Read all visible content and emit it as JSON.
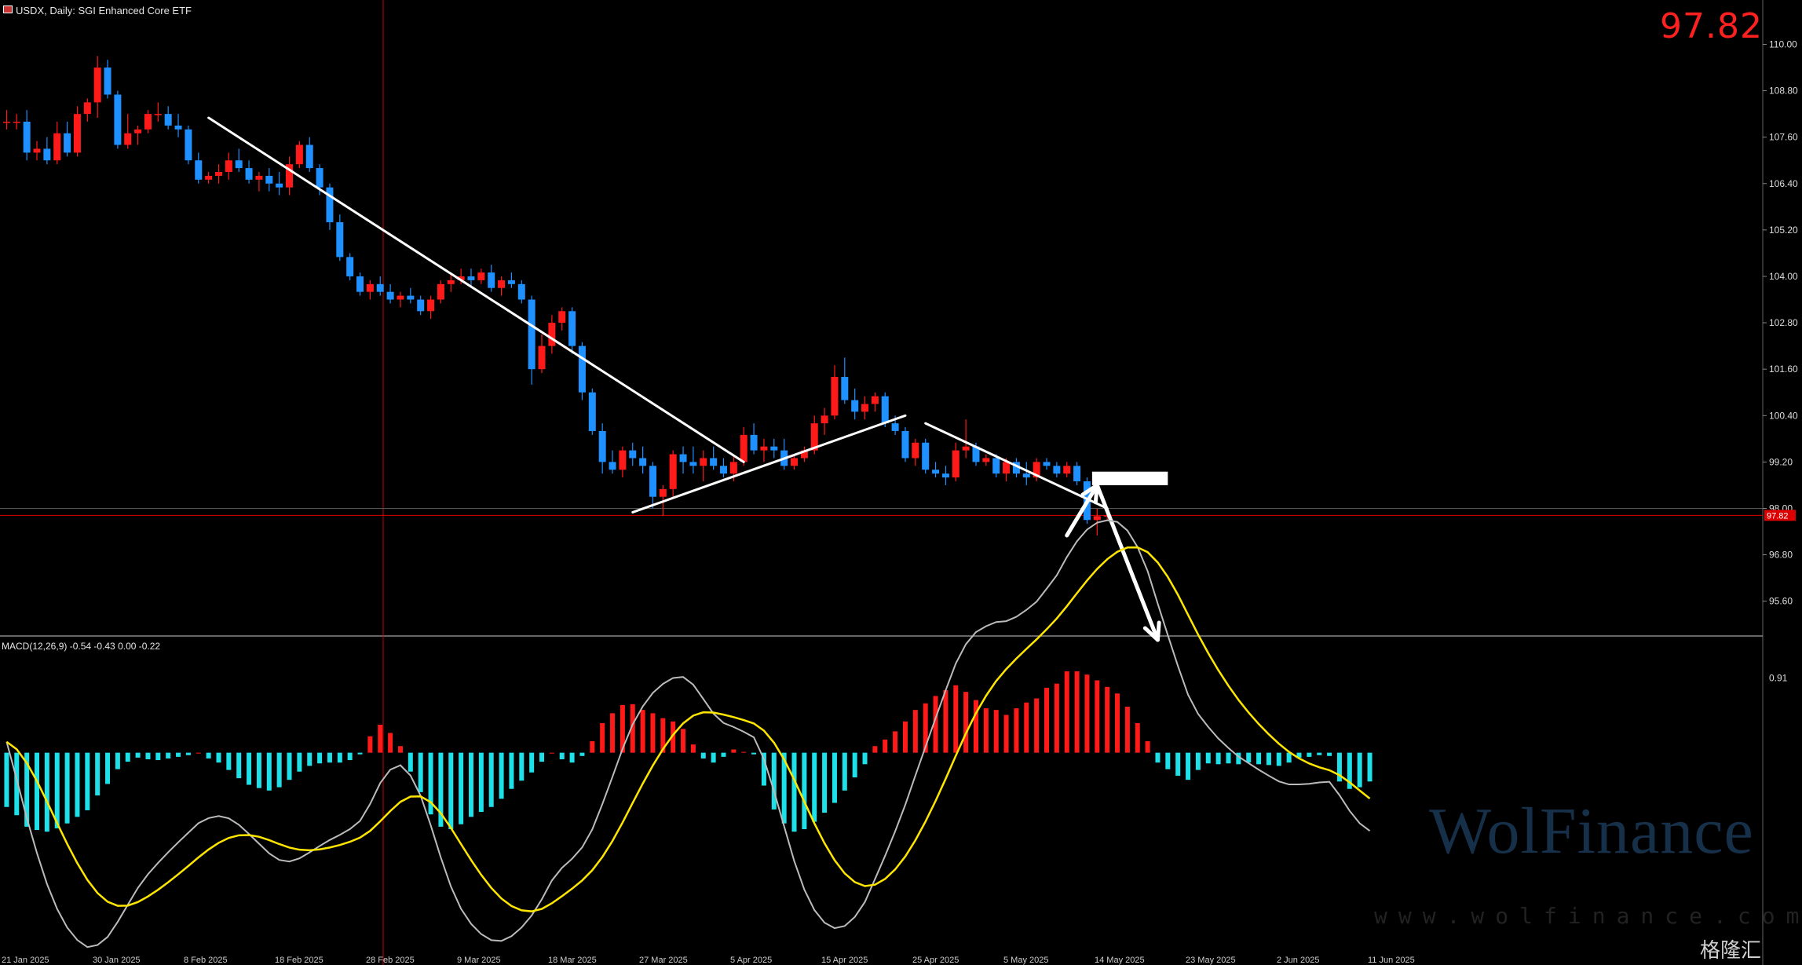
{
  "header": {
    "title": "USDX, Daily:  SGI Enhanced Core ETF"
  },
  "price_display": "97.82",
  "macd_label": "MACD(12,26,9) -0.54 -0.43 0.00 -0.22",
  "watermark": {
    "brand": "WolFinance",
    "url": "www.wolfinance.com"
  },
  "corner_logo": "格隆汇",
  "colors": {
    "up": "#ff1a1a",
    "down": "#1e90ff",
    "hist_pos": "#ff1a1a",
    "hist_neg": "#1ee0e8",
    "signal": "#ffe600",
    "macd": "#bbbbbb",
    "trend": "#ffffff"
  },
  "chart_data": [
    {
      "type": "candlestick",
      "y_ticks": [
        "110.00",
        "108.80",
        "107.60",
        "106.40",
        "105.20",
        "104.00",
        "102.80",
        "101.60",
        "100.40",
        "99.20",
        "98.00",
        "96.80",
        "95.60"
      ],
      "ylim": [
        94.7,
        110.7
      ],
      "current_price_label": "97.82",
      "x_labels": [
        "21 Jan 2025",
        "30 Jan 2025",
        "8 Feb 2025",
        "18 Feb 2025",
        "28 Feb 2025",
        "9 Mar 2025",
        "18 Mar 2025",
        "27 Mar 2025",
        "5 Apr 2025",
        "15 Apr 2025",
        "25 Apr 2025",
        "5 May 2025",
        "14 May 2025",
        "23 May 2025",
        "2 Jun 2025",
        "11 Jun 2025"
      ],
      "ohlc": [
        [
          108.0,
          108.3,
          107.8,
          108.0
        ],
        [
          108.0,
          108.2,
          107.8,
          108.0
        ],
        [
          108.0,
          108.3,
          107.0,
          107.2
        ],
        [
          107.2,
          107.5,
          107.0,
          107.3
        ],
        [
          107.3,
          107.6,
          106.9,
          107.0
        ],
        [
          107.0,
          108.0,
          106.9,
          107.7
        ],
        [
          107.7,
          108.0,
          107.1,
          107.2
        ],
        [
          107.2,
          108.4,
          107.1,
          108.2
        ],
        [
          108.2,
          108.6,
          108.0,
          108.5
        ],
        [
          108.5,
          109.7,
          108.1,
          109.4
        ],
        [
          109.4,
          109.6,
          108.6,
          108.7
        ],
        [
          108.7,
          108.8,
          107.3,
          107.4
        ],
        [
          107.4,
          108.2,
          107.3,
          107.7
        ],
        [
          107.7,
          107.9,
          107.4,
          107.8
        ],
        [
          107.8,
          108.3,
          107.7,
          108.2
        ],
        [
          108.2,
          108.5,
          108.0,
          108.2
        ],
        [
          108.2,
          108.4,
          107.8,
          107.9
        ],
        [
          107.9,
          108.2,
          107.6,
          107.8
        ],
        [
          107.8,
          107.9,
          106.9,
          107.0
        ],
        [
          107.0,
          107.2,
          106.4,
          106.5
        ],
        [
          106.5,
          106.7,
          106.4,
          106.6
        ],
        [
          106.6,
          106.9,
          106.4,
          106.7
        ],
        [
          106.7,
          107.2,
          106.5,
          107.0
        ],
        [
          107.0,
          107.3,
          106.7,
          106.8
        ],
        [
          106.8,
          107.0,
          106.4,
          106.5
        ],
        [
          106.5,
          106.7,
          106.2,
          106.6
        ],
        [
          106.6,
          106.8,
          106.2,
          106.4
        ],
        [
          106.4,
          106.7,
          106.1,
          106.3
        ],
        [
          106.3,
          107.1,
          106.1,
          106.9
        ],
        [
          106.9,
          107.5,
          106.8,
          107.4
        ],
        [
          107.4,
          107.6,
          106.7,
          106.8
        ],
        [
          106.8,
          106.9,
          106.1,
          106.3
        ],
        [
          106.3,
          106.4,
          105.2,
          105.4
        ],
        [
          105.4,
          105.6,
          104.4,
          104.5
        ],
        [
          104.5,
          104.6,
          103.9,
          104.0
        ],
        [
          104.0,
          104.1,
          103.5,
          103.6
        ],
        [
          103.6,
          103.9,
          103.4,
          103.8
        ],
        [
          103.8,
          104.0,
          103.5,
          103.6
        ],
        [
          103.6,
          103.8,
          103.3,
          103.4
        ],
        [
          103.4,
          103.6,
          103.2,
          103.5
        ],
        [
          103.5,
          103.7,
          103.3,
          103.4
        ],
        [
          103.4,
          103.5,
          103.0,
          103.1
        ],
        [
          103.1,
          103.5,
          102.9,
          103.4
        ],
        [
          103.4,
          103.9,
          103.3,
          103.8
        ],
        [
          103.8,
          104.1,
          103.6,
          103.9
        ],
        [
          103.9,
          104.2,
          103.8,
          104.0
        ],
        [
          104.0,
          104.2,
          103.7,
          103.9
        ],
        [
          103.9,
          104.2,
          103.8,
          104.1
        ],
        [
          104.1,
          104.3,
          103.6,
          103.7
        ],
        [
          103.7,
          104.0,
          103.5,
          103.9
        ],
        [
          103.9,
          104.1,
          103.7,
          103.8
        ],
        [
          103.8,
          103.9,
          103.3,
          103.4
        ],
        [
          103.4,
          103.5,
          101.2,
          101.6
        ],
        [
          101.6,
          102.5,
          101.5,
          102.2
        ],
        [
          102.2,
          103.0,
          102.0,
          102.8
        ],
        [
          102.8,
          103.2,
          102.6,
          103.1
        ],
        [
          103.1,
          103.2,
          102.0,
          102.2
        ],
        [
          102.2,
          102.3,
          100.8,
          101.0
        ],
        [
          101.0,
          101.1,
          99.9,
          100.0
        ],
        [
          100.0,
          100.2,
          98.9,
          99.2
        ],
        [
          99.2,
          99.5,
          98.9,
          99.0
        ],
        [
          99.0,
          99.6,
          98.8,
          99.5
        ],
        [
          99.5,
          99.7,
          99.1,
          99.3
        ],
        [
          99.3,
          99.6,
          98.9,
          99.1
        ],
        [
          99.1,
          99.2,
          98.0,
          98.3
        ],
        [
          98.3,
          98.6,
          97.8,
          98.5
        ],
        [
          98.5,
          99.5,
          98.3,
          99.4
        ],
        [
          99.4,
          99.6,
          98.9,
          99.2
        ],
        [
          99.2,
          99.6,
          98.9,
          99.1
        ],
        [
          99.1,
          99.5,
          98.7,
          99.3
        ],
        [
          99.3,
          99.6,
          99.0,
          99.1
        ],
        [
          99.1,
          99.3,
          98.8,
          98.9
        ],
        [
          98.9,
          99.4,
          98.7,
          99.2
        ],
        [
          99.2,
          100.1,
          99.1,
          99.9
        ],
        [
          99.9,
          100.2,
          99.4,
          99.5
        ],
        [
          99.5,
          99.8,
          99.2,
          99.6
        ],
        [
          99.6,
          99.8,
          99.3,
          99.5
        ],
        [
          99.5,
          99.8,
          99.0,
          99.1
        ],
        [
          99.1,
          99.4,
          99.0,
          99.3
        ],
        [
          99.3,
          99.6,
          99.2,
          99.5
        ],
        [
          99.5,
          100.4,
          99.4,
          100.2
        ],
        [
          100.2,
          100.6,
          99.9,
          100.4
        ],
        [
          100.4,
          101.7,
          100.3,
          101.4
        ],
        [
          101.4,
          101.9,
          100.7,
          100.8
        ],
        [
          100.8,
          101.1,
          100.3,
          100.5
        ],
        [
          100.5,
          100.9,
          100.3,
          100.7
        ],
        [
          100.7,
          101.0,
          100.5,
          100.9
        ],
        [
          100.9,
          101.0,
          100.1,
          100.2
        ],
        [
          100.2,
          100.4,
          99.9,
          100.0
        ],
        [
          100.0,
          100.1,
          99.2,
          99.3
        ],
        [
          99.3,
          99.8,
          99.1,
          99.7
        ],
        [
          99.7,
          99.8,
          98.9,
          99.0
        ],
        [
          99.0,
          99.2,
          98.8,
          98.9
        ],
        [
          98.9,
          99.1,
          98.6,
          98.8
        ],
        [
          98.8,
          99.7,
          98.7,
          99.5
        ],
        [
          99.5,
          100.3,
          99.3,
          99.6
        ],
        [
          99.6,
          99.7,
          99.1,
          99.2
        ],
        [
          99.2,
          99.4,
          99.1,
          99.3
        ],
        [
          99.3,
          99.4,
          98.8,
          98.9
        ],
        [
          98.9,
          99.3,
          98.7,
          99.2
        ],
        [
          99.2,
          99.3,
          98.8,
          98.9
        ],
        [
          98.9,
          99.2,
          98.6,
          98.8
        ],
        [
          98.8,
          99.3,
          98.7,
          99.2
        ],
        [
          99.2,
          99.3,
          99.0,
          99.1
        ],
        [
          99.1,
          99.2,
          98.8,
          98.9
        ],
        [
          98.9,
          99.2,
          98.8,
          99.1
        ],
        [
          99.1,
          99.2,
          98.6,
          98.7
        ],
        [
          98.7,
          98.8,
          97.6,
          97.7
        ],
        [
          97.7,
          98.0,
          97.3,
          97.8
        ],
        [
          97.8,
          97.9,
          97.7,
          97.82
        ]
      ],
      "trendlines": [
        {
          "from": [
            20,
            108.1
          ],
          "to": [
            73,
            99.2
          ]
        },
        {
          "from": [
            62,
            97.9
          ],
          "to": [
            89,
            100.4
          ]
        },
        {
          "from": [
            91,
            100.2
          ],
          "to": [
            109,
            98.0
          ]
        },
        {
          "from": [
            105,
            97.3
          ],
          "to": [
            108,
            98.6
          ]
        },
        {
          "from": [
            108,
            98.6
          ],
          "to": [
            114,
            94.6
          ]
        }
      ],
      "marked_zone": {
        "from": 107.5,
        "to": 115,
        "low": 98.6,
        "high": 98.95
      }
    },
    {
      "type": "macd",
      "params": "12,26,9",
      "y_tick": "0.91",
      "ylim": [
        -2.4,
        1.4
      ],
      "histogram": [
        -0.66,
        -0.76,
        -0.9,
        -0.94,
        -0.96,
        -0.92,
        -0.86,
        -0.78,
        -0.7,
        -0.52,
        -0.38,
        -0.2,
        -0.11,
        -0.06,
        -0.08,
        -0.09,
        -0.07,
        -0.05,
        -0.03,
        0.0,
        -0.07,
        -0.12,
        -0.21,
        -0.31,
        -0.39,
        -0.43,
        -0.46,
        -0.42,
        -0.33,
        -0.23,
        -0.16,
        -0.13,
        -0.12,
        -0.12,
        -0.09,
        -0.02,
        0.2,
        0.34,
        0.24,
        0.08,
        -0.23,
        -0.48,
        -0.75,
        -0.9,
        -0.93,
        -0.87,
        -0.78,
        -0.72,
        -0.66,
        -0.56,
        -0.44,
        -0.34,
        -0.24,
        -0.11,
        0.0,
        -0.08,
        -0.12,
        -0.04,
        0.14,
        0.36,
        0.48,
        0.58,
        0.59,
        0.52,
        0.48,
        0.42,
        0.38,
        0.29,
        0.1,
        -0.07,
        -0.12,
        -0.05,
        0.04,
        0.01,
        -0.02,
        -0.4,
        -0.69,
        -0.86,
        -0.96,
        -0.93,
        -0.84,
        -0.73,
        -0.61,
        -0.46,
        -0.3,
        -0.14,
        0.08,
        0.16,
        0.26,
        0.38,
        0.52,
        0.6,
        0.69,
        0.76,
        0.82,
        0.74,
        0.64,
        0.54,
        0.52,
        0.46,
        0.54,
        0.61,
        0.66,
        0.79,
        0.84,
        0.99,
        0.99,
        0.95,
        0.88,
        0.8,
        0.72,
        0.56,
        0.36,
        0.14,
        -0.12,
        -0.2,
        -0.28,
        -0.33,
        -0.21,
        -0.13,
        -0.14,
        -0.13,
        -0.14,
        -0.12,
        -0.14,
        -0.15,
        -0.16,
        -0.12,
        -0.06,
        -0.05,
        -0.03,
        -0.04,
        -0.35,
        -0.44,
        -0.42,
        -0.35
      ]
    }
  ]
}
